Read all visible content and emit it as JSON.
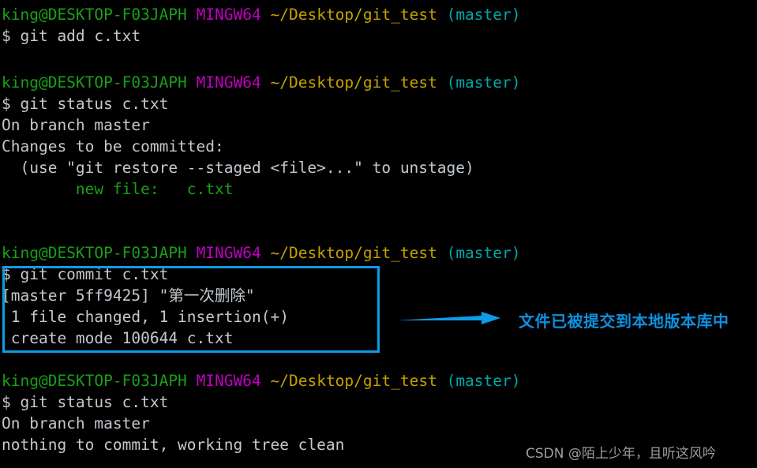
{
  "terminal": {
    "background_color": "#000000",
    "foreground_color": "#c3c9cf",
    "prompt": {
      "user_host": "king@DESKTOP-F03JAPH",
      "shell": "MINGW64",
      "path": "~/Desktop/git_test",
      "branch": "(master)",
      "user_host_color": "#18a018",
      "shell_color": "#c000c0",
      "path_color": "#c4a000",
      "branch_color": "#00a8a8"
    },
    "blocks": [
      {
        "command": "$ git add c.txt",
        "output": []
      },
      {
        "command": "$ git status c.txt",
        "output": [
          "On branch master",
          "Changes to be committed:",
          "  (use \"git restore --staged <file>...\" to unstage)"
        ],
        "staged_line": "        new file:   c.txt"
      },
      {
        "command": "$ git commit c.txt",
        "output": [
          "[master 5ff9425] \"第一次删除\"",
          " 1 file changed, 1 insertion(+)",
          " create mode 100644 c.txt"
        ]
      },
      {
        "command": "$ git status c.txt",
        "output": [
          "On branch master",
          "nothing to commit, working tree clean"
        ]
      }
    ]
  },
  "annotations": {
    "highlight_box_color": "#0e9ce6",
    "arrow_color": "#0e9ce6",
    "label": "文件已被提交到本地版本库中",
    "label_color": "#0e90e0"
  },
  "watermark": {
    "text": "CSDN @陌上少年，且听这风吟",
    "color": "#b9b9b9"
  }
}
